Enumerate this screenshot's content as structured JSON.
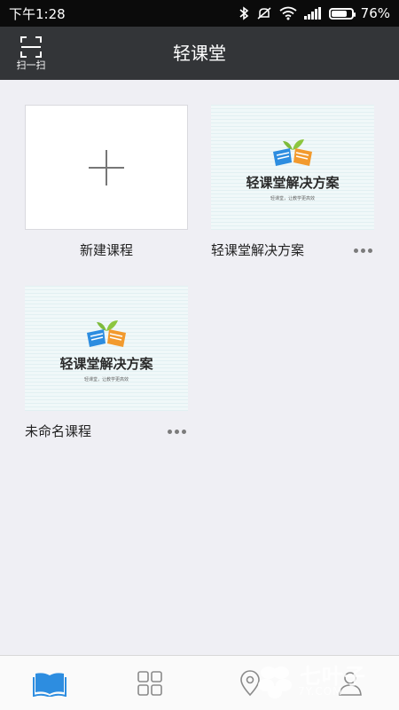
{
  "status_bar": {
    "time": "下午1:28",
    "battery_percent_text": "76%",
    "battery_level": 0.76
  },
  "header": {
    "title": "轻课堂",
    "scan_label": "扫一扫"
  },
  "courses": [
    {
      "name": "新建课程",
      "type": "new"
    },
    {
      "name": "轻课堂解决方案",
      "type": "course",
      "thumb_brand": "轻课堂解决方案",
      "thumb_slogan": "轻课堂，让教学更高效"
    },
    {
      "name": "未命名课程",
      "type": "course",
      "thumb_brand": "轻课堂解决方案",
      "thumb_slogan": "轻课堂，让教学更高效"
    }
  ],
  "tabbar": {
    "active_color": "#2d8de0",
    "inactive_color": "#8a8a8a",
    "tabs": [
      {
        "icon": "book-icon",
        "active": true
      },
      {
        "icon": "grid-icon",
        "active": false
      },
      {
        "icon": "location-pin-icon",
        "active": false
      },
      {
        "icon": "person-icon",
        "active": false
      }
    ]
  },
  "watermark": {
    "text": "七叶子",
    "url": "7Y.COM"
  }
}
